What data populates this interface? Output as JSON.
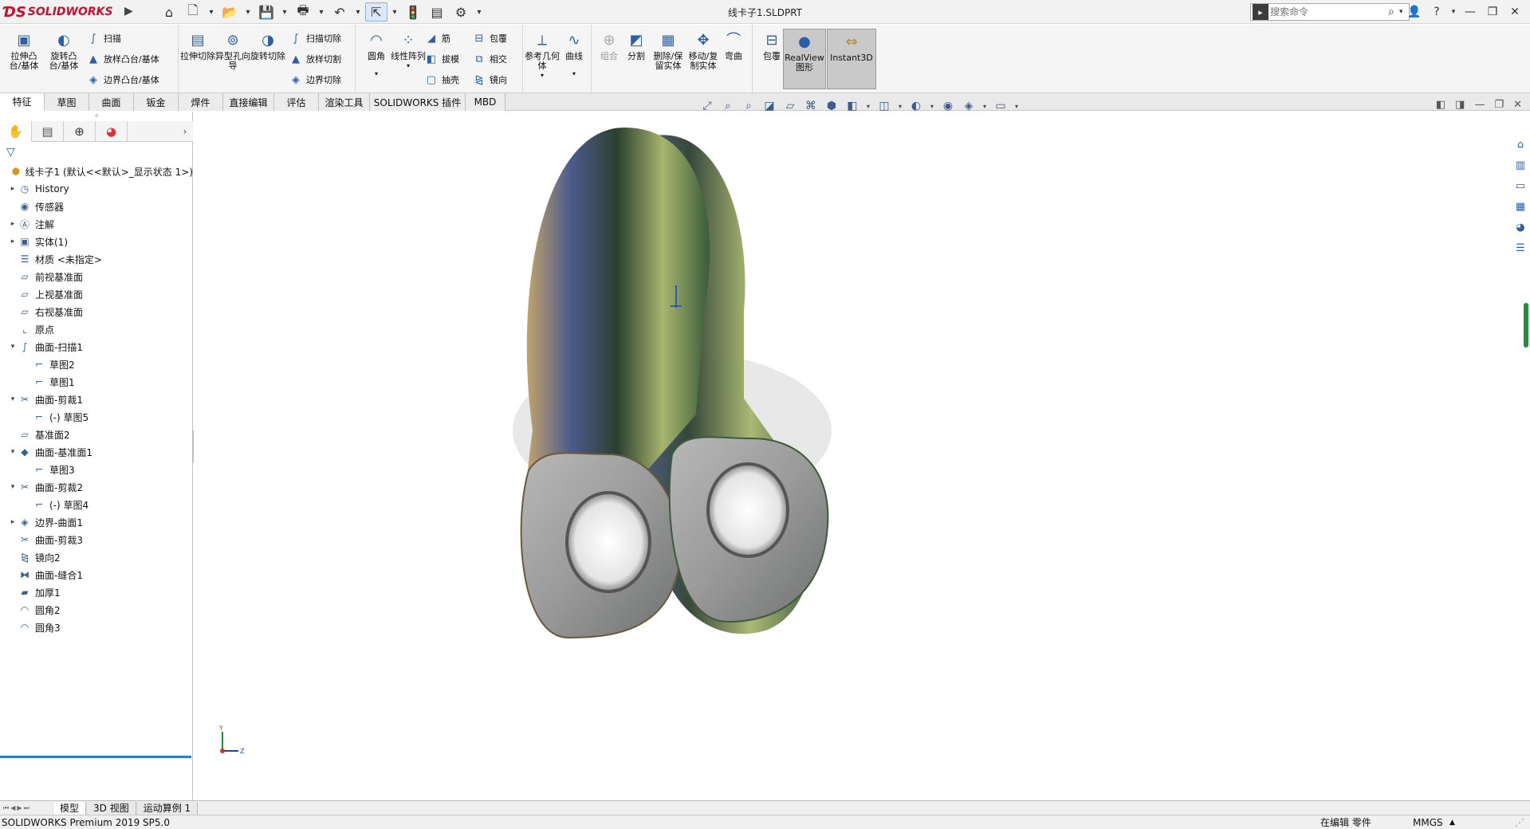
{
  "app": {
    "brand": "SOLIDWORKS",
    "doc_title": "线卡子1.SLDPRT"
  },
  "search": {
    "placeholder": "搜索命令"
  },
  "ribbon": {
    "extrude_boss": "拉伸凸台/基体",
    "revolve_boss": "旋转凸台/基体",
    "sweep": "扫描",
    "loft": "放样凸台/基体",
    "boundary": "边界凸台/基体",
    "extrude_cut": "拉伸切除",
    "hole_wizard": "异型孔向导",
    "revolve_cut": "旋转切除",
    "sweep_cut": "扫描切除",
    "loft_cut": "放样切割",
    "boundary_cut": "边界切除",
    "fillet": "圆角",
    "linear_pattern": "线性阵列",
    "rib": "筋",
    "draft": "拔模",
    "shell": "抽壳",
    "wrap": "包覆",
    "intersect": "相交",
    "mirror": "镜向",
    "ref_geometry": "参考几何体",
    "curves": "曲线",
    "combine": "组合",
    "split": "分割",
    "delete_keep": "删除/保留实体",
    "move_copy": "移动/复制实体",
    "flex": "弯曲",
    "wrap2": "包覆",
    "realview": "RealView图形",
    "instant3d": "Instant3D"
  },
  "tabs": [
    "特征",
    "草图",
    "曲面",
    "钣金",
    "焊件",
    "直接编辑",
    "评估",
    "渲染工具",
    "SOLIDWORKS 插件",
    "MBD"
  ],
  "tree": [
    {
      "label": "线卡子1 (默认<<默认>_显示状态 1>)",
      "icon": "part-icon"
    },
    {
      "label": "History",
      "icon": "history-folder-icon"
    },
    {
      "label": "传感器",
      "icon": "sensor-folder-icon"
    },
    {
      "label": "注解",
      "icon": "annotation-icon"
    },
    {
      "label": "实体(1)",
      "icon": "solid-bodies-icon"
    },
    {
      "label": "材质 <未指定>",
      "icon": "material-icon"
    },
    {
      "label": "前视基准面",
      "icon": "plane-icon"
    },
    {
      "label": "上视基准面",
      "icon": "plane-icon"
    },
    {
      "label": "右视基准面",
      "icon": "plane-icon"
    },
    {
      "label": "原点",
      "icon": "origin-icon"
    },
    {
      "label": "曲面-扫描1",
      "icon": "surface-sweep-icon"
    },
    {
      "label": "草图2",
      "icon": "sketch-icon"
    },
    {
      "label": "草图1",
      "icon": "sketch-icon"
    },
    {
      "label": "曲面-剪裁1",
      "icon": "surface-trim-icon"
    },
    {
      "label": "(-) 草图5",
      "icon": "sketch-icon"
    },
    {
      "label": "基准面2",
      "icon": "plane-icon"
    },
    {
      "label": "曲面-基准面1",
      "icon": "planar-surface-icon"
    },
    {
      "label": "草图3",
      "icon": "sketch-icon"
    },
    {
      "label": "曲面-剪裁2",
      "icon": "surface-trim-icon"
    },
    {
      "label": "(-) 草图4",
      "icon": "sketch-icon"
    },
    {
      "label": "边界-曲面1",
      "icon": "boundary-surface-icon"
    },
    {
      "label": "曲面-剪裁3",
      "icon": "surface-trim-icon"
    },
    {
      "label": "镜向2",
      "icon": "mirror-icon"
    },
    {
      "label": "曲面-缝合1",
      "icon": "knit-icon"
    },
    {
      "label": "加厚1",
      "icon": "thicken-icon"
    },
    {
      "label": "圆角2",
      "icon": "fillet-icon"
    },
    {
      "label": "圆角3",
      "icon": "fillet-icon"
    }
  ],
  "bottom_tabs": [
    "模型",
    "3D 视图",
    "运动算例 1"
  ],
  "status": {
    "product": "SOLIDWORKS Premium 2019 SP5.0",
    "editing": "在编辑 零件",
    "units": "MMGS"
  },
  "triad": {
    "y": "Y",
    "z": "Z"
  },
  "colors": {
    "accent": "#2b5fa8",
    "brand": "#c8102e",
    "tree_end": "#2a7fc1"
  }
}
